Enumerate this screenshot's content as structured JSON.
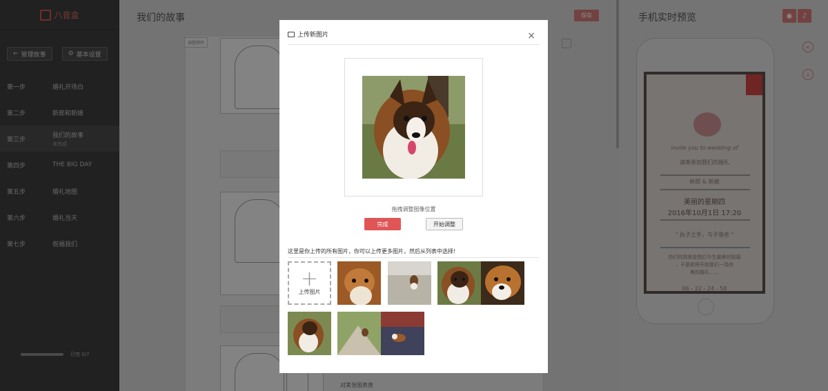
{
  "sidebar": {
    "brand": "八音盒",
    "buttons": {
      "manage": "管理故事",
      "settings": "基本设置"
    },
    "steps": [
      {
        "no": "第一步",
        "label": "婚礼开场白",
        "sub": ""
      },
      {
        "no": "第二步",
        "label": "新郎和新娘",
        "sub": ""
      },
      {
        "no": "第三步",
        "label": "我们的故事",
        "sub": "未完成"
      },
      {
        "no": "第四步",
        "label": "THE BIG DAY",
        "sub": ""
      },
      {
        "no": "第五步",
        "label": "婚礼地图",
        "sub": ""
      },
      {
        "no": "第六步",
        "label": "婚礼当天",
        "sub": ""
      },
      {
        "no": "第七步",
        "label": "祝福我们",
        "sub": ""
      }
    ],
    "progress_text": "已完 0/7"
  },
  "main": {
    "title": "我们的故事",
    "save_label": "保存",
    "tag": "调整顺序",
    "caption": "对某张图表直"
  },
  "preview": {
    "title": "手机实时预览",
    "screen": {
      "script": "invite you to wedding of",
      "names_script": "请来参加我们的婚礼",
      "couple": "新郎 & 新娘",
      "day": "美丽的星期四",
      "datetime": "2016年10月1日  17:20",
      "quote": "\" 执子之手，与子偕老 \"",
      "message1": "你们的到来是我们今生最美的祝福",
      "message2": "，于是即将开始我们一场完",
      "message3": "美的婚礼……",
      "countdown": "06 - 22 - 24 - 58"
    }
  },
  "modal": {
    "title": "上传新图片",
    "close_glyph": "×",
    "hint": "拖拽调整图像位置",
    "done_label": "完成",
    "adjust_label": "开始调整",
    "list_label": "这里是你上传的所有图片，你可以上传更多图片，然后从列表中选择!",
    "upload_label": "上传图片"
  },
  "colors": {
    "accent": "#e05656",
    "sidebar_bg": "#3d3d3d",
    "overlay": "rgba(0,0,0,0.45)"
  }
}
